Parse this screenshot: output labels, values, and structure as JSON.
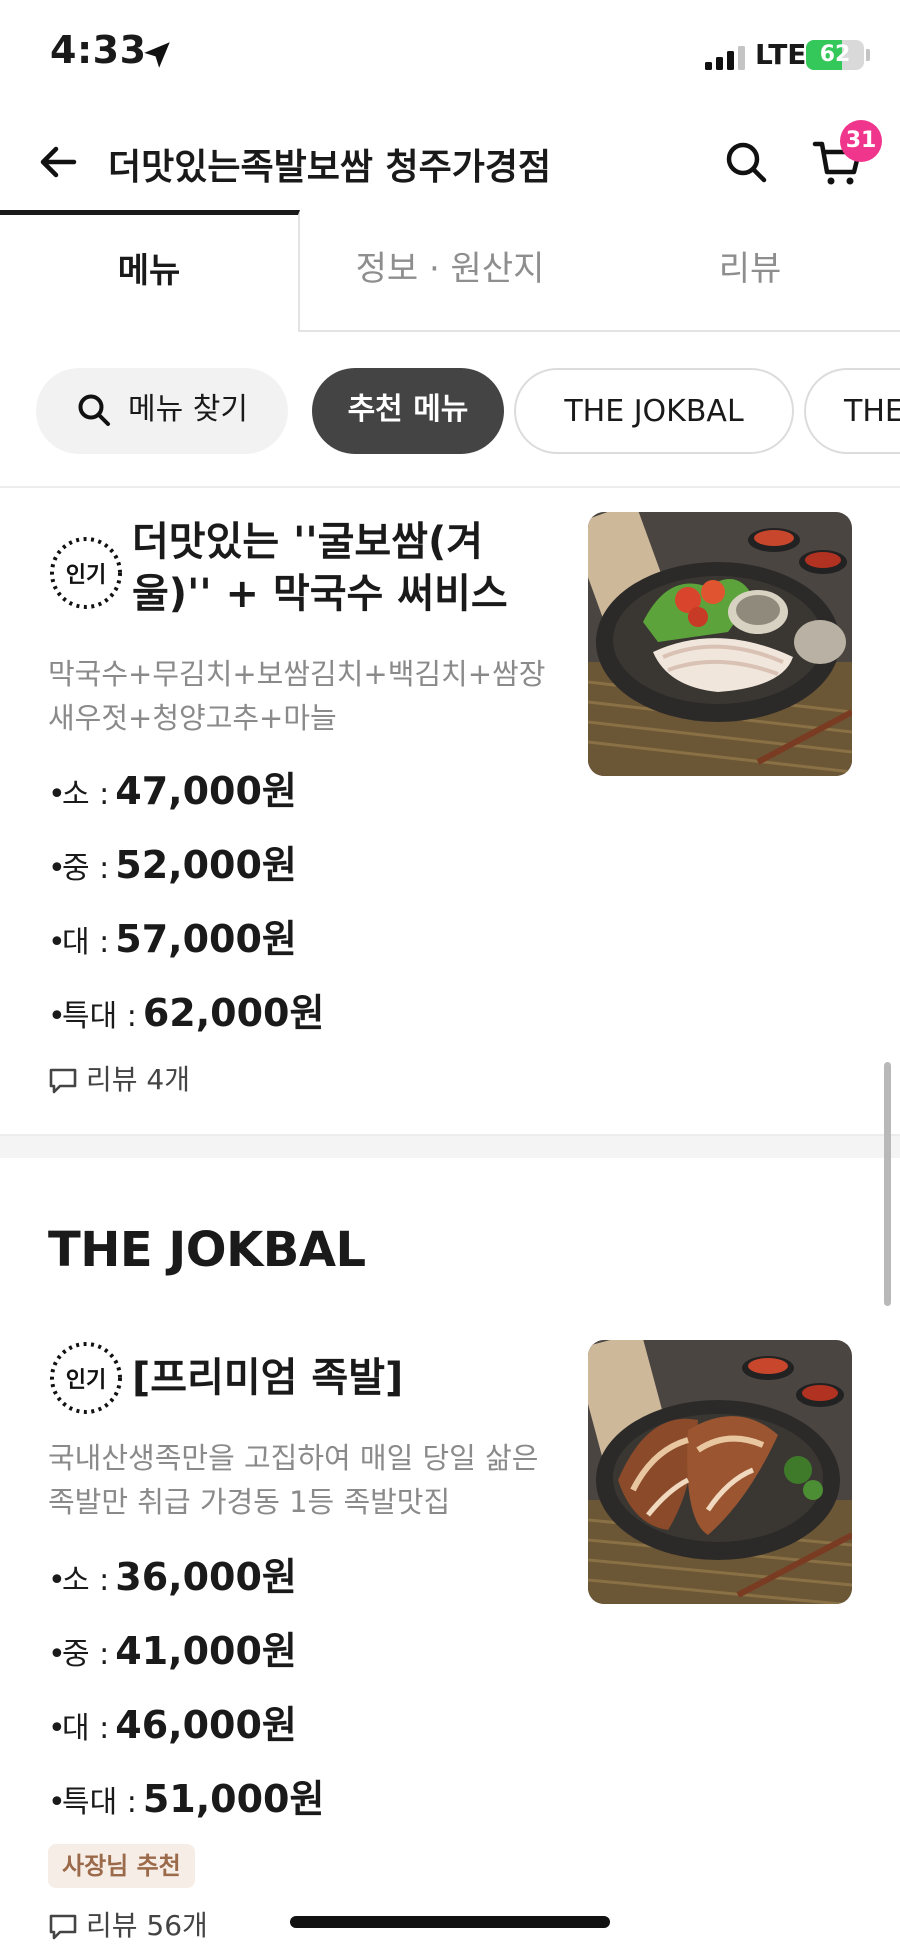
{
  "status_bar": {
    "time": "4:33",
    "network": "LTE",
    "battery_level": "62",
    "battery_fraction": 0.62
  },
  "header": {
    "title": "더맛있는족발보쌈 청주가경점",
    "cart_count": "31"
  },
  "tabs": [
    {
      "label": "메뉴",
      "active": true
    },
    {
      "label": "정보 · 원산지",
      "active": false
    },
    {
      "label": "리뷰",
      "active": false
    }
  ],
  "chips": {
    "search_label": "메뉴 찾기",
    "recommended_label": "추천 메뉴",
    "jokbal_label": "THE JOKBAL",
    "partial_label": "THE"
  },
  "items": [
    {
      "badge": "인기",
      "name": "더맛있는 ''굴보쌈(겨울)'' + 막국수 써비스",
      "description": "막국수+무김치+보쌈김치+백김치+쌈장새우젓+청양고추+마늘",
      "prices": [
        {
          "size": "소 :",
          "amount": "47,000원"
        },
        {
          "size": "중 :",
          "amount": "52,000원"
        },
        {
          "size": "대 :",
          "amount": "57,000원"
        },
        {
          "size": "특대 :",
          "amount": "62,000원"
        }
      ],
      "reviews": "리뷰 4개"
    },
    {
      "badge": "인기",
      "name": "[프리미엄 족발]",
      "description": "국내산생족만을 고집하여 매일 당일 삶은 족발만 취급 가경동 1등 족발맛집",
      "prices": [
        {
          "size": "소 :",
          "amount": "36,000원"
        },
        {
          "size": "중 :",
          "amount": "41,000원"
        },
        {
          "size": "대 :",
          "amount": "46,000원"
        },
        {
          "size": "특대 :",
          "amount": "51,000원"
        }
      ],
      "owner_badge": "사장님 추천",
      "reviews": "리뷰 56개"
    }
  ],
  "section": {
    "title": "THE JOKBAL"
  },
  "colors": {
    "cart_badge": "#f0368c",
    "battery": "#34c759",
    "chip_active": "#444444",
    "owner_badge_bg": "#f6ede6",
    "owner_badge_text": "#9a6a4a"
  }
}
